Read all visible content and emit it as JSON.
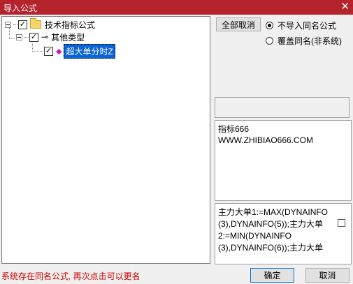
{
  "window": {
    "title": "导入公式",
    "close_glyph": "✕"
  },
  "tree": {
    "root": {
      "label": "技术指标公式",
      "expander": "−",
      "checked": "✓"
    },
    "child": {
      "label": "其他类型",
      "expander": "−",
      "checked": "✓",
      "icon_glyph": "⊸"
    },
    "leaf": {
      "label": "超大单分时Z",
      "checked": "✓",
      "icon_glyph": "◆"
    }
  },
  "buttons": {
    "cancel_all": "全部取消",
    "ok": "确定",
    "cancel": "取消"
  },
  "options": {
    "radio1": {
      "label": "不导入同名公式",
      "selected": true
    },
    "radio2": {
      "label": "覆盖同名(非系统)",
      "selected": false
    }
  },
  "info": {
    "line1": "指标666",
    "line2": "WWW.ZHIBIAO666.COM"
  },
  "formula": {
    "lines": [
      "主力大单1:=MAX(DYNAINFO",
      "(3),DYNAINFO(5));主力大单",
      "2:=MIN(DYNAINFO",
      "(3),DYNAINFO(6));主力大单"
    ]
  },
  "status": {
    "message": "系统存在同名公式, 再次点击可以更名"
  },
  "colors": {
    "titlebar": "#b5232c",
    "selection": "#0a64d6",
    "status_text": "#d00000"
  },
  "icons": [
    "close-icon",
    "folder-icon",
    "key-icon",
    "formula-icon"
  ]
}
